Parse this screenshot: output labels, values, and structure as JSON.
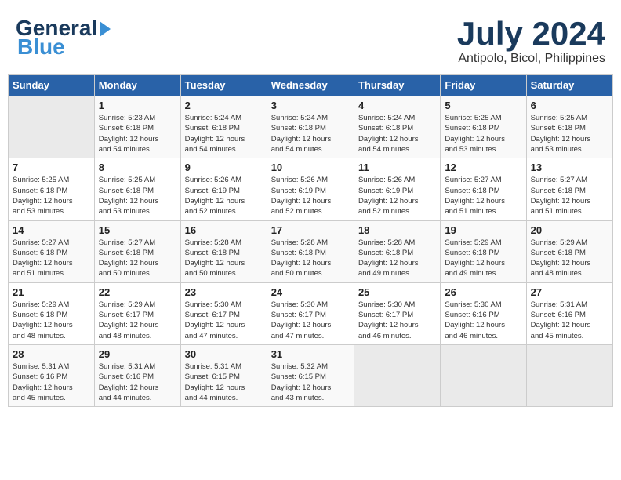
{
  "header": {
    "logo_general": "General",
    "logo_blue": "Blue",
    "month_year": "July 2024",
    "location": "Antipolo, Bicol, Philippines"
  },
  "calendar": {
    "days_of_week": [
      "Sunday",
      "Monday",
      "Tuesday",
      "Wednesday",
      "Thursday",
      "Friday",
      "Saturday"
    ],
    "weeks": [
      [
        {
          "day": "",
          "info": ""
        },
        {
          "day": "1",
          "info": "Sunrise: 5:23 AM\nSunset: 6:18 PM\nDaylight: 12 hours\nand 54 minutes."
        },
        {
          "day": "2",
          "info": "Sunrise: 5:24 AM\nSunset: 6:18 PM\nDaylight: 12 hours\nand 54 minutes."
        },
        {
          "day": "3",
          "info": "Sunrise: 5:24 AM\nSunset: 6:18 PM\nDaylight: 12 hours\nand 54 minutes."
        },
        {
          "day": "4",
          "info": "Sunrise: 5:24 AM\nSunset: 6:18 PM\nDaylight: 12 hours\nand 54 minutes."
        },
        {
          "day": "5",
          "info": "Sunrise: 5:25 AM\nSunset: 6:18 PM\nDaylight: 12 hours\nand 53 minutes."
        },
        {
          "day": "6",
          "info": "Sunrise: 5:25 AM\nSunset: 6:18 PM\nDaylight: 12 hours\nand 53 minutes."
        }
      ],
      [
        {
          "day": "7",
          "info": "Sunrise: 5:25 AM\nSunset: 6:18 PM\nDaylight: 12 hours\nand 53 minutes."
        },
        {
          "day": "8",
          "info": "Sunrise: 5:25 AM\nSunset: 6:18 PM\nDaylight: 12 hours\nand 53 minutes."
        },
        {
          "day": "9",
          "info": "Sunrise: 5:26 AM\nSunset: 6:19 PM\nDaylight: 12 hours\nand 52 minutes."
        },
        {
          "day": "10",
          "info": "Sunrise: 5:26 AM\nSunset: 6:19 PM\nDaylight: 12 hours\nand 52 minutes."
        },
        {
          "day": "11",
          "info": "Sunrise: 5:26 AM\nSunset: 6:19 PM\nDaylight: 12 hours\nand 52 minutes."
        },
        {
          "day": "12",
          "info": "Sunrise: 5:27 AM\nSunset: 6:18 PM\nDaylight: 12 hours\nand 51 minutes."
        },
        {
          "day": "13",
          "info": "Sunrise: 5:27 AM\nSunset: 6:18 PM\nDaylight: 12 hours\nand 51 minutes."
        }
      ],
      [
        {
          "day": "14",
          "info": "Sunrise: 5:27 AM\nSunset: 6:18 PM\nDaylight: 12 hours\nand 51 minutes."
        },
        {
          "day": "15",
          "info": "Sunrise: 5:27 AM\nSunset: 6:18 PM\nDaylight: 12 hours\nand 50 minutes."
        },
        {
          "day": "16",
          "info": "Sunrise: 5:28 AM\nSunset: 6:18 PM\nDaylight: 12 hours\nand 50 minutes."
        },
        {
          "day": "17",
          "info": "Sunrise: 5:28 AM\nSunset: 6:18 PM\nDaylight: 12 hours\nand 50 minutes."
        },
        {
          "day": "18",
          "info": "Sunrise: 5:28 AM\nSunset: 6:18 PM\nDaylight: 12 hours\nand 49 minutes."
        },
        {
          "day": "19",
          "info": "Sunrise: 5:29 AM\nSunset: 6:18 PM\nDaylight: 12 hours\nand 49 minutes."
        },
        {
          "day": "20",
          "info": "Sunrise: 5:29 AM\nSunset: 6:18 PM\nDaylight: 12 hours\nand 48 minutes."
        }
      ],
      [
        {
          "day": "21",
          "info": "Sunrise: 5:29 AM\nSunset: 6:18 PM\nDaylight: 12 hours\nand 48 minutes."
        },
        {
          "day": "22",
          "info": "Sunrise: 5:29 AM\nSunset: 6:17 PM\nDaylight: 12 hours\nand 48 minutes."
        },
        {
          "day": "23",
          "info": "Sunrise: 5:30 AM\nSunset: 6:17 PM\nDaylight: 12 hours\nand 47 minutes."
        },
        {
          "day": "24",
          "info": "Sunrise: 5:30 AM\nSunset: 6:17 PM\nDaylight: 12 hours\nand 47 minutes."
        },
        {
          "day": "25",
          "info": "Sunrise: 5:30 AM\nSunset: 6:17 PM\nDaylight: 12 hours\nand 46 minutes."
        },
        {
          "day": "26",
          "info": "Sunrise: 5:30 AM\nSunset: 6:16 PM\nDaylight: 12 hours\nand 46 minutes."
        },
        {
          "day": "27",
          "info": "Sunrise: 5:31 AM\nSunset: 6:16 PM\nDaylight: 12 hours\nand 45 minutes."
        }
      ],
      [
        {
          "day": "28",
          "info": "Sunrise: 5:31 AM\nSunset: 6:16 PM\nDaylight: 12 hours\nand 45 minutes."
        },
        {
          "day": "29",
          "info": "Sunrise: 5:31 AM\nSunset: 6:16 PM\nDaylight: 12 hours\nand 44 minutes."
        },
        {
          "day": "30",
          "info": "Sunrise: 5:31 AM\nSunset: 6:15 PM\nDaylight: 12 hours\nand 44 minutes."
        },
        {
          "day": "31",
          "info": "Sunrise: 5:32 AM\nSunset: 6:15 PM\nDaylight: 12 hours\nand 43 minutes."
        },
        {
          "day": "",
          "info": ""
        },
        {
          "day": "",
          "info": ""
        },
        {
          "day": "",
          "info": ""
        }
      ]
    ]
  }
}
